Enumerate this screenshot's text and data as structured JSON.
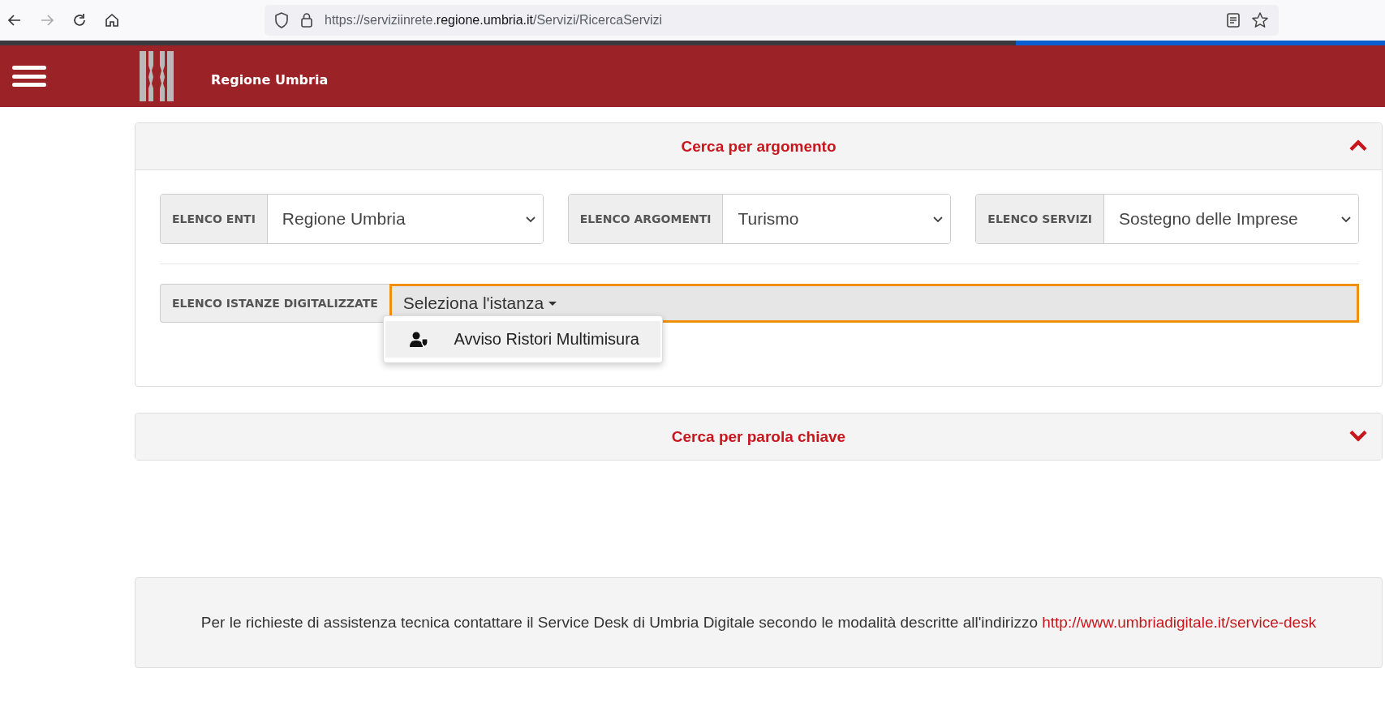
{
  "browser": {
    "url_prefix": "https://serviziinrete.",
    "url_domain": "regione.umbria.it",
    "url_path": "/Servizi/RicercaServizi"
  },
  "header": {
    "title": "Regione Umbria"
  },
  "panels": [
    {
      "title": "Cerca per argomento",
      "expanded": true,
      "filters": [
        {
          "label": "ELENCO ENTI",
          "value": "Regione Umbria"
        },
        {
          "label": "ELENCO ARGOMENTI",
          "value": "Turismo"
        },
        {
          "label": "ELENCO SERVIZI",
          "value": "Sostegno delle Imprese"
        }
      ],
      "instance": {
        "label": "ELENCO ISTANZE DIGITALIZZATE",
        "value": "Seleziona l'istanza",
        "focused": true,
        "menu": [
          {
            "label": "Avviso Ristori Multimisura",
            "selected": true
          }
        ]
      }
    },
    {
      "title": "Cerca per parola chiave",
      "expanded": false
    }
  ],
  "footer": {
    "text": "Per le richieste di assistenza tecnica contattare il Service Desk di Umbria Digitale secondo le modalità  descritte all'indirizzo",
    "link": "http://www.umbriadigitale.it/service-desk"
  }
}
